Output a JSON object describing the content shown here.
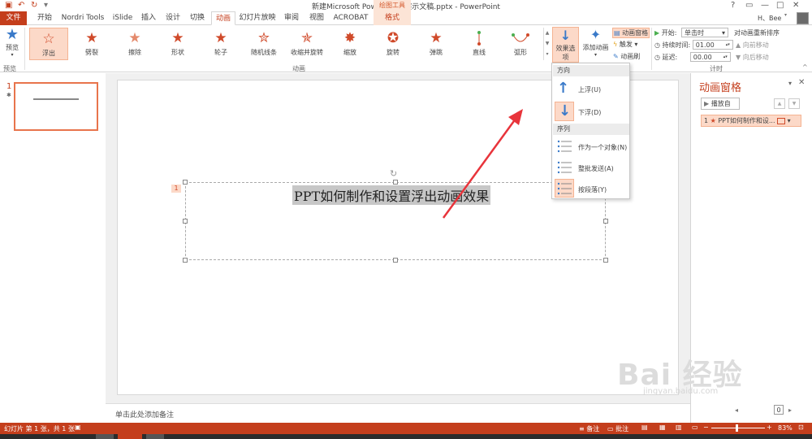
{
  "title_bar": {
    "doc_title": "新建Microsoft PowerPoint 演示文稿.pptx - PowerPoint",
    "drawing_tools": "绘图工具",
    "help": "?",
    "user": "H、Bee"
  },
  "tabs": [
    "文件",
    "开始",
    "Nordri Tools",
    "iSlide",
    "插入",
    "设计",
    "切换",
    "动画",
    "幻灯片放映",
    "审阅",
    "视图",
    "ACROBAT",
    "格式"
  ],
  "ribbon": {
    "preview": "预览",
    "preview_group": "预览",
    "animation_group": "动画",
    "timing_group": "计时",
    "animations": [
      {
        "label": "浮出",
        "icon": "float-out-star-icon"
      },
      {
        "label": "劈裂",
        "icon": "split-star-icon"
      },
      {
        "label": "擦除",
        "icon": "wipe-star-icon"
      },
      {
        "label": "形状",
        "icon": "shape-star-icon"
      },
      {
        "label": "轮子",
        "icon": "wheel-star-icon"
      },
      {
        "label": "随机线条",
        "icon": "random-bars-star-icon"
      },
      {
        "label": "收缩并旋转",
        "icon": "shrink-turn-star-icon"
      },
      {
        "label": "缩放",
        "icon": "zoom-star-icon"
      },
      {
        "label": "旋转",
        "icon": "spin-star-icon"
      },
      {
        "label": "弹跳",
        "icon": "bounce-star-icon"
      },
      {
        "label": "直线",
        "icon": "line-path-icon"
      },
      {
        "label": "弧形",
        "icon": "arc-path-icon"
      }
    ],
    "effect_options": "效果选项",
    "add_animation": "添加动画",
    "animation_pane": "动画窗格",
    "trigger": "触发",
    "animation_painter": "动画刷",
    "start_label": "开始:",
    "start_value": "单击时",
    "duration_label": "持续时间:",
    "duration_value": "01.00",
    "delay_label": "延迟:",
    "delay_value": "00.00",
    "reorder": "对动画重新排序",
    "move_earlier": "向前移动",
    "move_later": "向后移动"
  },
  "thumb": {
    "number": "1",
    "star": "✱"
  },
  "slide": {
    "text": "PPT如何制作和设置浮出动画效果",
    "anim_tag": "1"
  },
  "dropdown": {
    "direction_header": "方向",
    "float_up": "上浮(U)",
    "float_down": "下浮(D)",
    "sequence_header": "序列",
    "as_one_object": "作为一个对象(N)",
    "all_at_once": "整批发送(A)",
    "by_paragraph": "按段落(Y)"
  },
  "anim_pane": {
    "title": "动画窗格",
    "play_from": "播放自",
    "item_number": "1",
    "item_text": "PPT如何制作和设..."
  },
  "notes": "单击此处添加备注",
  "status": {
    "slide_info": "幻灯片 第 1 张，共 1 张",
    "notes_btn": "备注",
    "comments_btn": "批注",
    "zoom": "83%",
    "page_box": "0"
  },
  "watermark": {
    "main": "Bai 经验",
    "sub": "jingyan.baidu.com"
  },
  "colors": {
    "accent": "#c43e1c",
    "selection": "#fcd9c8",
    "blue_arrow": "#3a7ac9",
    "red_arrow": "#e8343b"
  }
}
